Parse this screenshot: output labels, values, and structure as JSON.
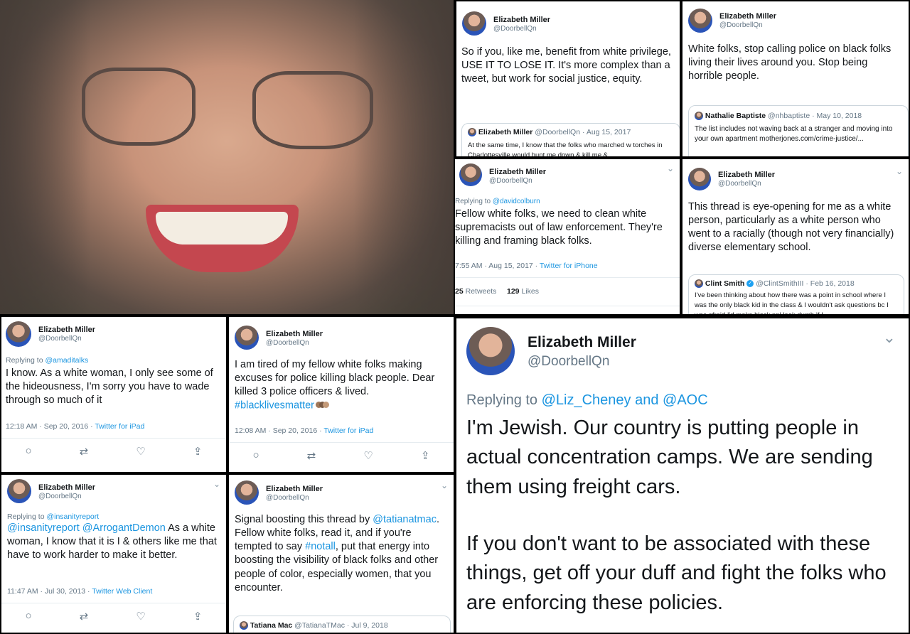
{
  "colors": {
    "link": "#1b95e0",
    "muted": "#657786",
    "text": "#14171a",
    "border": "#ccd6dd"
  },
  "profile": {
    "name": "Elizabeth Miller",
    "handle": "@DoorbellQn"
  },
  "t1": {
    "body": "So if you, like me, benefit from white privilege, USE IT TO LOSE IT. It's more complex than a tweet, but work for social justice, equity.",
    "quote": {
      "name": "Elizabeth Miller",
      "handle": "@DoorbellQn",
      "date": "· Aug 15, 2017",
      "text": "At the same time, I know that the folks who marched w torches in Charlottesville would hunt me down & kill me &"
    }
  },
  "t2": {
    "body": "White folks, stop calling police on black folks living their lives around you. Stop being horrible people.",
    "quote": {
      "name": "Nathalie Baptiste",
      "handle": "@nhbaptiste",
      "date": "· May 10, 2018",
      "text": "The list includes not waving back at a stranger and moving into your own apartment motherjones.com/crime-justice/..."
    }
  },
  "t3": {
    "replying_prefix": "Replying to",
    "replying_to": "@davidcolburn",
    "body": "Fellow white folks, we need to clean white supremacists out of law enforcement. They're killing and framing black folks.",
    "time": "7:55 AM · Aug 15, 2017 · ",
    "client": "Twitter for iPhone",
    "retweets": "25",
    "retweets_label": "Retweets",
    "likes": "129",
    "likes_label": "Likes"
  },
  "t4": {
    "body": "This thread is eye-opening for me as a white person, particularly as a white person who went to a racially (though not very financially) diverse elementary school.",
    "quote": {
      "name": "Clint Smith",
      "handle": "@ClintSmithIII",
      "date": "· Feb 16, 2018",
      "text": "I've been thinking about how there was a point in school where I was the only black kid in the class & I wouldn't ask questions bc I was afraid I'd make black ppl look dumb if I"
    }
  },
  "t5": {
    "replying_prefix": "Replying to",
    "replying_to": "@amaditalks",
    "body": "I know. As a white woman, I only see some of the hideousness, I'm sorry you have to wade through so much of it",
    "time": "12:18 AM · Sep 20, 2016 · ",
    "client": "Twitter for iPad"
  },
  "t6": {
    "body": "I am tired of my fellow white folks making excuses for police killing black people. Dear killed 3 police officers & lived.",
    "hashtag": "#blacklivesmatter",
    "time": "12:08 AM · Sep 20, 2016 · ",
    "client": "Twitter for iPad"
  },
  "t7": {
    "body": "I'm Jewish. Our country is putting people in actual concentration camps. We are sending them using freight cars.",
    "body2": "If you don't want to be associated with these things, get off your duff and fight the folks who are enforcing these policies.",
    "replying_prefix": "Replying to",
    "replying_to": "@Liz_Cheney and @AOC"
  },
  "t8": {
    "replying_prefix": "Replying to",
    "replying_to": "@insanityreport",
    "mention1": "@insanityreport",
    "mention2": "@ArrogantDemon",
    "body": " As a white woman, I know that it is I & others like me that have to work harder to make it better.",
    "time": "11:47 AM · Jul 30, 2013 · ",
    "client": "Twitter Web Client"
  },
  "t9": {
    "p1": "Signal boosting this thread by ",
    "m1": "@tatianatmac",
    "p2": ". Fellow white folks, read it, and if you're tempted to say ",
    "m2": "#notall",
    "p3": ", put that energy into boosting the visibility of black folks and other people of color, especially women, that you encounter.",
    "quote": {
      "name": "Tatiana Mac",
      "handle": "@TatianaTMac",
      "date": "· Jul 9, 2018"
    }
  },
  "icons": [
    "reply-icon",
    "retweet-icon",
    "like-icon",
    "share-icon",
    "chevron-down-icon",
    "verified-icon"
  ]
}
